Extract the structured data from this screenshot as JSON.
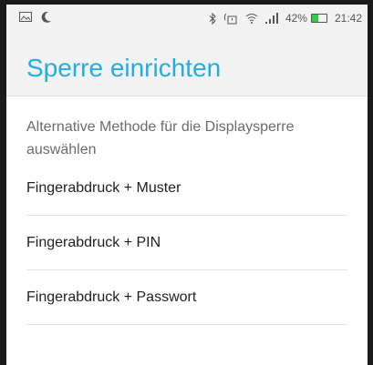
{
  "status_bar": {
    "battery_percent": "42%",
    "battery_level": 0.42,
    "time": "21:42",
    "icons": [
      "image-notification-icon",
      "moon-icon",
      "bluetooth-icon",
      "alarm-icon",
      "wifi-icon",
      "signal-icon",
      "battery-icon"
    ]
  },
  "header": {
    "title": "Sperre einrichten"
  },
  "main": {
    "subtitle": "Alternative Methode für die Displaysperre auswählen",
    "options": [
      {
        "label": "Fingerabdruck + Muster"
      },
      {
        "label": "Fingerabdruck + PIN"
      },
      {
        "label": "Fingerabdruck + Passwort"
      }
    ]
  },
  "colors": {
    "accent": "#23aee3",
    "battery": "#35c84a"
  }
}
